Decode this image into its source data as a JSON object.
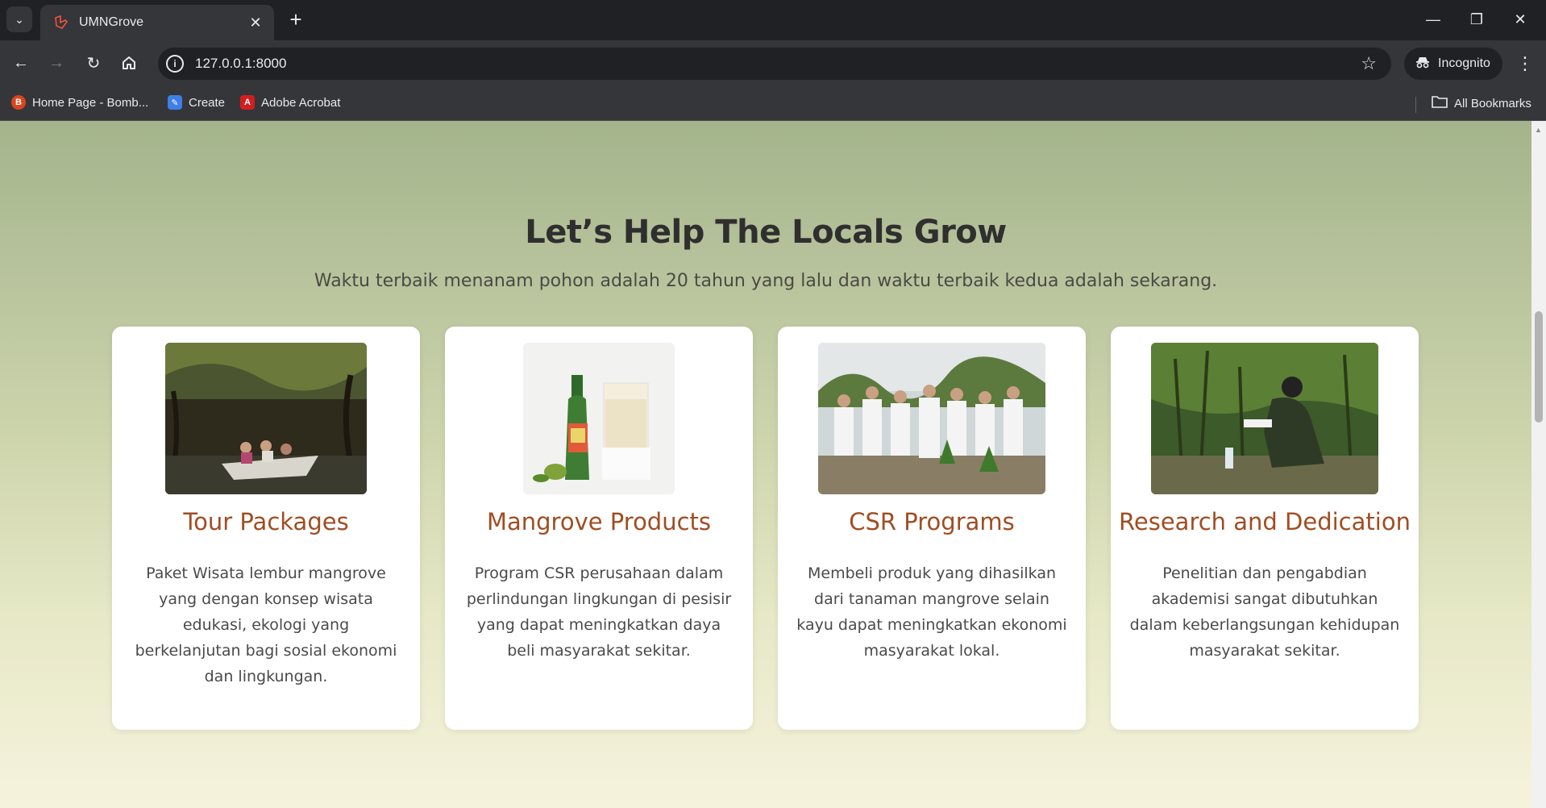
{
  "browser": {
    "tab_title": "UMNGrove",
    "url": "127.0.0.1:8000",
    "incognito_label": "Incognito",
    "bookmarks": [
      {
        "label": "Home Page - Bomb...",
        "icon": "bombay-favicon"
      },
      {
        "label": "Create",
        "icon": "create-favicon"
      },
      {
        "label": "Adobe Acrobat",
        "icon": "acrobat-icon"
      }
    ],
    "all_bookmarks_label": "All Bookmarks"
  },
  "hero": {
    "title": "Let’s Help The Locals Grow",
    "subtitle": "Waktu terbaik menanam pohon adalah 20 tahun yang lalu dan waktu terbaik kedua adalah sekarang."
  },
  "cards": [
    {
      "title": "Tour Packages",
      "text": "Paket Wisata lembur mangrove yang dengan konsep wisata edukasi, ekologi yang berkelanjutan bagi sosial ekonomi dan lingkungan.",
      "image": "boat-tour-photo"
    },
    {
      "title": "Mangrove Products",
      "text": "Program CSR perusahaan dalam perlindungan lingkungan di pesisir yang dapat meningkatkan daya beli masyarakat sekitar.",
      "image": "syrup-bottle-photo"
    },
    {
      "title": "CSR Programs",
      "text": "Membeli produk yang dihasilkan dari tanaman mangrove selain kayu dapat meningkatkan ekonomi masyarakat lokal.",
      "image": "group-planting-photo"
    },
    {
      "title": "Research and Dedication",
      "text": "Penelitian dan pengabdian akademisi sangat dibutuhkan dalam keberlangsungan kehidupan masyarakat sekitar.",
      "image": "researcher-photo"
    }
  ],
  "colors": {
    "card_title": "#a04d22",
    "headline": "#2f2f2f",
    "bg_top": "#a4b48b",
    "bg_bottom": "#f6f3dd"
  }
}
